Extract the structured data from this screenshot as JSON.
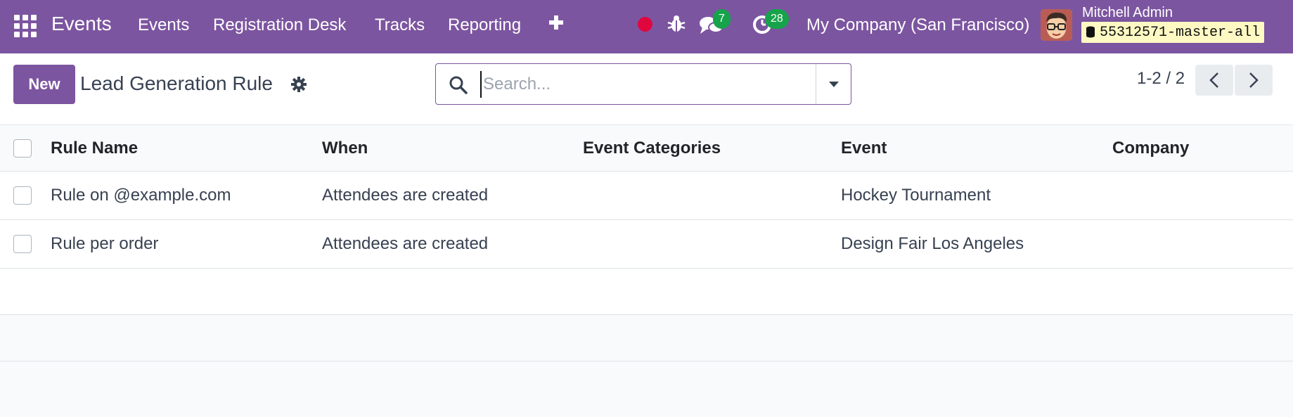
{
  "navbar": {
    "brand": "Events",
    "menu": [
      "Events",
      "Registration Desk",
      "Tracks",
      "Reporting"
    ],
    "chat_count": "7",
    "activity_count": "28",
    "company": "My Company (San Francisco)",
    "user_name": "Mitchell Admin",
    "database": "55312571-master-all",
    "colors": {
      "bar": "#7c55a0",
      "badge": "#16a34a",
      "record": "#e0073f"
    }
  },
  "control": {
    "new_label": "New",
    "title": "Lead Generation Rule",
    "search_placeholder": "Search...",
    "pager": "1-2 / 2"
  },
  "table": {
    "columns": [
      "Rule Name",
      "When",
      "Event Categories",
      "Event",
      "Company"
    ],
    "rows": [
      {
        "name": "Rule on @example.com",
        "when": "Attendees are created",
        "categories": "",
        "event": "Hockey Tournament",
        "company": ""
      },
      {
        "name": "Rule per order",
        "when": "Attendees are created",
        "categories": "",
        "event": "Design Fair Los Angeles",
        "company": ""
      }
    ]
  }
}
